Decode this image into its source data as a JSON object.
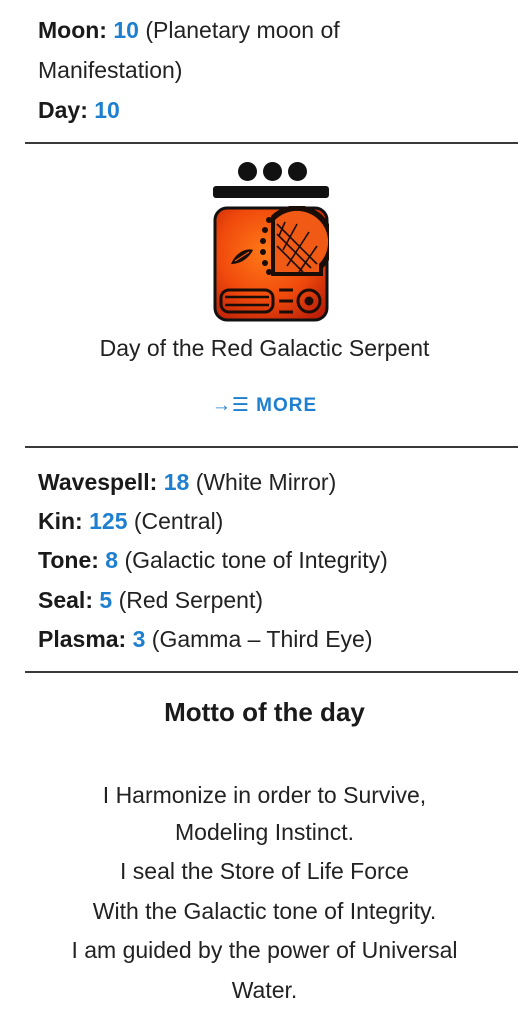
{
  "moon": {
    "label": "Moon:",
    "value": "10",
    "note_line1": "(Planetary moon of",
    "note_line2": "Manifestation)"
  },
  "day": {
    "label": "Day:",
    "value": "10"
  },
  "seal_card": {
    "tone_dots": 3,
    "tone_bars": 1,
    "glyph_icon": "red-serpent-glyph-icon",
    "glyph_colors": {
      "background_outer": "#b81d08",
      "background_inner": "#ff6a10",
      "border": "#111111"
    },
    "caption": "Day of the Red Galactic Serpent",
    "more_label": "→☰ MORE"
  },
  "details": [
    {
      "label": "Wavespell:",
      "value": "18",
      "note": "(White Mirror)"
    },
    {
      "label": "Kin:",
      "value": "125",
      "note": "(Central)"
    },
    {
      "label": "Tone:",
      "value": "8",
      "note": "(Galactic tone of Integrity)"
    },
    {
      "label": "Seal:",
      "value": "5",
      "note": "(Red Serpent)"
    },
    {
      "label": "Plasma:",
      "value": "3",
      "note": "(Gamma – Third Eye)"
    }
  ],
  "motto": {
    "title": "Motto of the day",
    "lines": [
      "I Harmonize in order to Survive,",
      "Modeling Instinct.",
      "I seal the Store of Life Force",
      "With the Galactic tone of Integrity.",
      "I am guided by the power of Universal",
      "Water."
    ]
  },
  "colors": {
    "accent": "#1e7fd0",
    "text": "#222222",
    "divider": "#3a3a3a"
  }
}
